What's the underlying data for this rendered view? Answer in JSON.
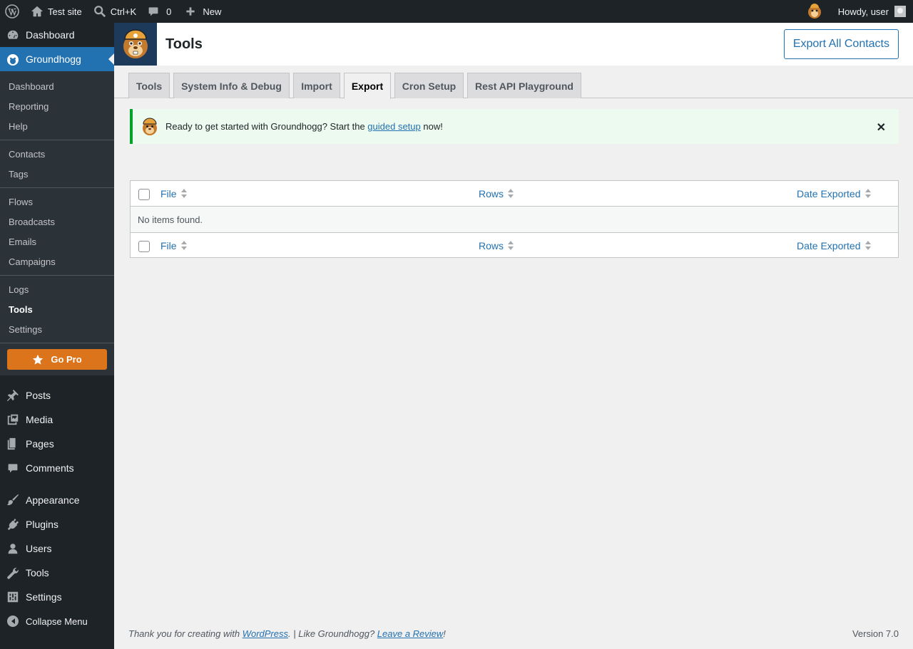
{
  "adminbar": {
    "site_name": "Test site",
    "search_shortcut": "Ctrl+K",
    "comments_count": "0",
    "new_label": "New",
    "greeting": "Howdy, user"
  },
  "sidebar": {
    "top_items": [
      {
        "label": "Dashboard",
        "icon": "dashboard-icon"
      },
      {
        "label": "Groundhogg",
        "icon": "groundhogg-icon"
      }
    ],
    "groundhogg_submenu": [
      "Dashboard",
      "Reporting",
      "Help",
      "Contacts",
      "Tags",
      "Flows",
      "Broadcasts",
      "Emails",
      "Campaigns",
      "Logs",
      "Tools",
      "Settings"
    ],
    "go_pro": "Go Pro",
    "main_items": [
      {
        "label": "Posts",
        "icon": "pin-icon"
      },
      {
        "label": "Media",
        "icon": "media-icon"
      },
      {
        "label": "Pages",
        "icon": "pages-icon"
      },
      {
        "label": "Comments",
        "icon": "comments-icon"
      },
      {
        "label": "Appearance",
        "icon": "brush-icon"
      },
      {
        "label": "Plugins",
        "icon": "plug-icon"
      },
      {
        "label": "Users",
        "icon": "user-icon"
      },
      {
        "label": "Tools",
        "icon": "wrench-icon"
      },
      {
        "label": "Settings",
        "icon": "sliders-icon"
      }
    ],
    "collapse": "Collapse Menu"
  },
  "header": {
    "title": "Tools",
    "export_button": "Export All Contacts"
  },
  "tabs": [
    "Tools",
    "System Info & Debug",
    "Import",
    "Export",
    "Cron Setup",
    "Rest API Playground"
  ],
  "active_tab": "Export",
  "notice": {
    "before": "Ready to get started with Groundhogg? Start the ",
    "link": "guided setup",
    "after": " now!",
    "close": "✕"
  },
  "table": {
    "columns": [
      "File",
      "Rows",
      "Date Exported"
    ],
    "empty_message": "No items found."
  },
  "footer": {
    "thanks_before": "Thank you for creating with ",
    "wp_link": "WordPress",
    "thanks_mid": ". | Like Groundhogg? ",
    "review_link": "Leave a Review",
    "thanks_after": "!",
    "version": "Version 7.0"
  },
  "colors": {
    "accent": "#2271b1",
    "admin_dark": "#1d2327",
    "go_pro": "#db741a",
    "notice_success": "#00a32a"
  }
}
